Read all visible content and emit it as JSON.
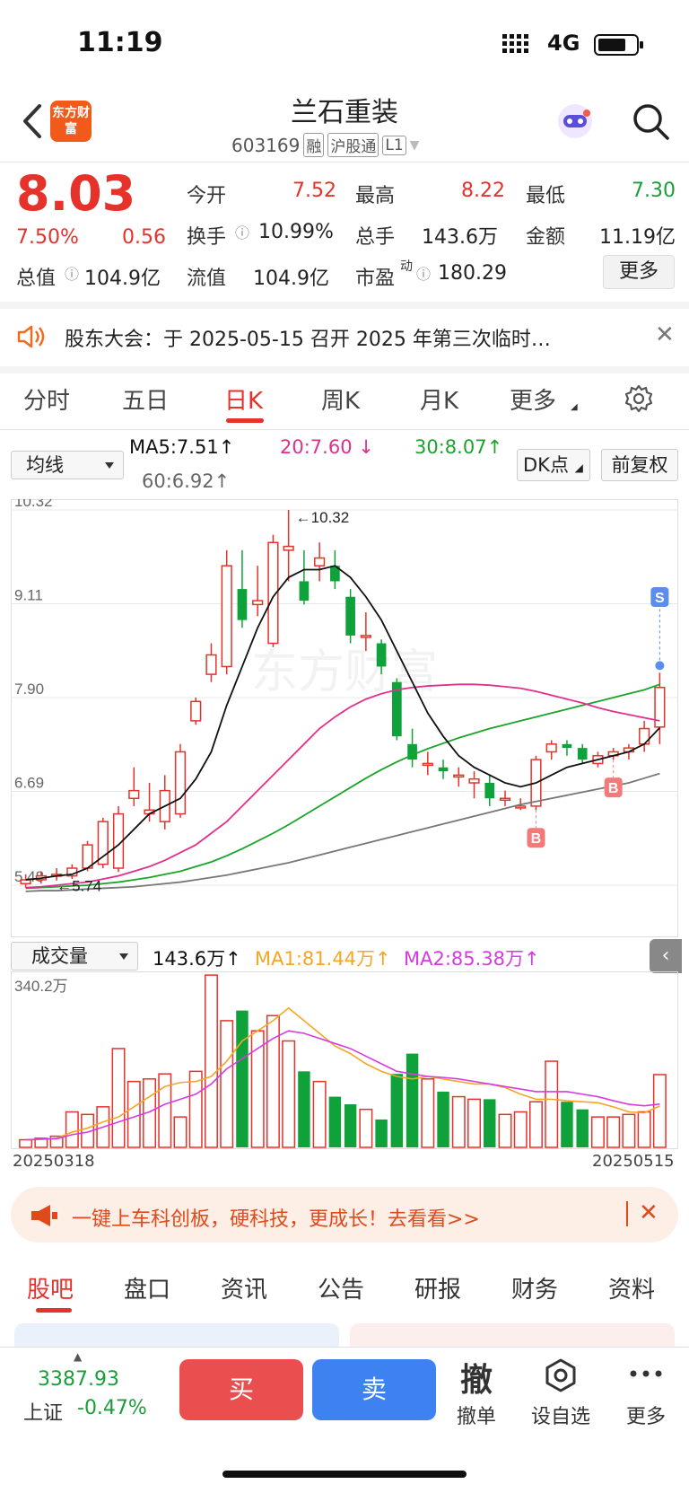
{
  "status_bar": {
    "time": "11:19",
    "network": "4G"
  },
  "header": {
    "logo_text": "东方财富",
    "stock_name": "兰石重装",
    "stock_code": "603169",
    "tags": [
      "融",
      "沪股通",
      "L1"
    ]
  },
  "quote": {
    "price": "8.03",
    "change_pct": "7.50%",
    "change": "0.56",
    "stats": [
      {
        "label": "今开",
        "value": "7.52"
      },
      {
        "label": "最高",
        "value": "8.22"
      },
      {
        "label": "最低",
        "value": "7.30"
      },
      {
        "label": "换手",
        "value": "10.99%"
      },
      {
        "label": "总手",
        "value": "143.6万"
      },
      {
        "label": "金额",
        "value": "11.19亿"
      },
      {
        "label": "总值",
        "value": "104.9亿"
      },
      {
        "label": "流值",
        "value": "104.9亿"
      },
      {
        "label": "市盈",
        "value": "180.29",
        "superscript": "动"
      }
    ],
    "more_label": "更多"
  },
  "notice": {
    "text": "股东大会：于 2025-05-15 召开 2025 年第三次临时…"
  },
  "period_tabs": [
    "分时",
    "五日",
    "日K",
    "周K",
    "月K",
    "更多"
  ],
  "active_period": "日K",
  "ma_legend": {
    "select_label": "均线",
    "ma5": "MA5:7.51",
    "ma20": "20:7.60",
    "ma30": "30:8.07",
    "ma60": "60:6.92",
    "dk_label": "DK点",
    "adjust_label": "前复权",
    "colors": {
      "ma5": "#111111",
      "ma20": "#e0308c",
      "ma30": "#1aa52a",
      "ma60": "#777777"
    }
  },
  "chart_data": [
    {
      "type": "candlestick",
      "title": "日K",
      "y_ticks": [
        "10.32",
        "9.11",
        "7.90",
        "6.69",
        "5.48"
      ],
      "ylim": [
        5.48,
        10.32
      ],
      "watermark": "东方财富",
      "annotations": [
        "10.32",
        "5.74"
      ],
      "signal_markers": [
        "S",
        "B",
        "B"
      ],
      "candles": [
        [
          5.5,
          5.55,
          5.62,
          5.45
        ],
        [
          5.55,
          5.6,
          5.66,
          5.5
        ],
        [
          5.6,
          5.62,
          5.7,
          5.54
        ],
        [
          5.6,
          5.7,
          5.75,
          5.56
        ],
        [
          5.7,
          6.0,
          6.05,
          5.66
        ],
        [
          5.75,
          6.3,
          6.35,
          5.7
        ],
        [
          5.7,
          6.4,
          6.5,
          5.65
        ],
        [
          6.6,
          6.7,
          7.0,
          6.5
        ],
        [
          6.4,
          6.45,
          6.8,
          6.3
        ],
        [
          6.3,
          6.7,
          6.9,
          6.2
        ],
        [
          6.4,
          7.2,
          7.3,
          6.35
        ],
        [
          7.6,
          7.85,
          7.9,
          7.55
        ],
        [
          8.2,
          8.45,
          8.6,
          8.1
        ],
        [
          8.3,
          9.6,
          9.8,
          8.2
        ],
        [
          9.3,
          8.9,
          9.8,
          8.8
        ],
        [
          9.1,
          9.15,
          9.6,
          8.95
        ],
        [
          8.6,
          9.9,
          10.0,
          8.55
        ],
        [
          9.8,
          9.85,
          10.32,
          9.4
        ],
        [
          9.4,
          9.15,
          9.8,
          9.1
        ],
        [
          9.6,
          9.7,
          9.9,
          9.4
        ],
        [
          9.6,
          9.4,
          9.8,
          9.3
        ],
        [
          9.2,
          8.7,
          9.3,
          8.6
        ],
        [
          8.7,
          8.7,
          9.0,
          8.5
        ],
        [
          8.6,
          8.3,
          8.65,
          8.2
        ],
        [
          8.1,
          7.4,
          8.15,
          7.35
        ],
        [
          7.3,
          7.1,
          7.5,
          7.0
        ],
        [
          7.05,
          7.05,
          7.2,
          6.9
        ],
        [
          7.0,
          6.95,
          7.1,
          6.85
        ],
        [
          6.9,
          6.9,
          7.0,
          6.75
        ],
        [
          6.8,
          6.85,
          6.95,
          6.6
        ],
        [
          6.8,
          6.6,
          6.9,
          6.5
        ],
        [
          6.6,
          6.6,
          6.7,
          6.5
        ],
        [
          6.5,
          6.5,
          6.6,
          6.45
        ],
        [
          6.5,
          7.1,
          7.15,
          6.45
        ],
        [
          7.2,
          7.3,
          7.35,
          7.1
        ],
        [
          7.3,
          7.25,
          7.35,
          7.15
        ],
        [
          7.25,
          7.1,
          7.3,
          7.05
        ],
        [
          7.05,
          7.15,
          7.2,
          7.0
        ],
        [
          7.15,
          7.2,
          7.25,
          7.1
        ],
        [
          7.2,
          7.25,
          7.3,
          7.1
        ],
        [
          7.3,
          7.5,
          7.6,
          7.2
        ],
        [
          7.52,
          8.03,
          8.22,
          7.3
        ]
      ],
      "ma5": [
        5.55,
        5.57,
        5.6,
        5.62,
        5.7,
        5.85,
        6.0,
        6.2,
        6.4,
        6.5,
        6.6,
        6.85,
        7.2,
        7.8,
        8.3,
        8.8,
        9.2,
        9.45,
        9.55,
        9.55,
        9.6,
        9.45,
        9.2,
        8.9,
        8.5,
        8.1,
        7.7,
        7.4,
        7.15,
        7.0,
        6.9,
        6.8,
        6.75,
        6.8,
        6.9,
        7.0,
        7.05,
        7.1,
        7.15,
        7.2,
        7.3,
        7.51
      ],
      "ma20": [
        5.45,
        5.46,
        5.48,
        5.5,
        5.52,
        5.56,
        5.6,
        5.66,
        5.72,
        5.8,
        5.9,
        6.0,
        6.15,
        6.3,
        6.5,
        6.7,
        6.9,
        7.1,
        7.3,
        7.5,
        7.65,
        7.78,
        7.88,
        7.95,
        8.0,
        8.03,
        8.05,
        8.06,
        8.07,
        8.07,
        8.06,
        8.04,
        8.02,
        7.98,
        7.93,
        7.88,
        7.83,
        7.77,
        7.72,
        7.68,
        7.64,
        7.6
      ],
      "ma30": [
        5.44,
        5.45,
        5.46,
        5.47,
        5.48,
        5.5,
        5.52,
        5.55,
        5.58,
        5.62,
        5.66,
        5.72,
        5.78,
        5.86,
        5.95,
        6.05,
        6.15,
        6.26,
        6.38,
        6.5,
        6.62,
        6.74,
        6.86,
        6.97,
        7.07,
        7.16,
        7.24,
        7.31,
        7.38,
        7.44,
        7.5,
        7.55,
        7.6,
        7.65,
        7.7,
        7.75,
        7.8,
        7.85,
        7.9,
        7.95,
        8.0,
        8.07
      ],
      "ma60": [
        5.4,
        5.41,
        5.41,
        5.42,
        5.43,
        5.44,
        5.45,
        5.46,
        5.48,
        5.5,
        5.52,
        5.55,
        5.58,
        5.61,
        5.65,
        5.69,
        5.73,
        5.77,
        5.82,
        5.87,
        5.92,
        5.97,
        6.02,
        6.07,
        6.12,
        6.17,
        6.22,
        6.27,
        6.32,
        6.37,
        6.42,
        6.47,
        6.52,
        6.56,
        6.6,
        6.64,
        6.68,
        6.72,
        6.76,
        6.8,
        6.86,
        6.92
      ]
    },
    {
      "type": "bar",
      "title": "成交量",
      "y_max_label": "340.2万",
      "x_start_label": "20250318",
      "x_end_label": "20250515",
      "values": [
        15,
        18,
        22,
        70,
        65,
        80,
        195,
        130,
        135,
        145,
        60,
        150,
        340,
        250,
        270,
        230,
        260,
        210,
        150,
        130,
        100,
        85,
        75,
        55,
        145,
        185,
        135,
        110,
        100,
        95,
        95,
        65,
        70,
        90,
        170,
        90,
        75,
        60,
        60,
        65,
        70,
        143.6
      ],
      "ma1_values": [
        15,
        16,
        18,
        30,
        38,
        50,
        60,
        80,
        100,
        120,
        128,
        130,
        140,
        170,
        210,
        230,
        250,
        275,
        250,
        225,
        200,
        185,
        165,
        150,
        140,
        135,
        140,
        135,
        130,
        125,
        125,
        118,
        105,
        95,
        95,
        92,
        90,
        88,
        80,
        70,
        68,
        81.44
      ],
      "ma2_values": [
        15,
        16,
        17,
        25,
        30,
        40,
        50,
        60,
        70,
        85,
        95,
        105,
        125,
        155,
        175,
        195,
        215,
        230,
        225,
        215,
        205,
        195,
        180,
        165,
        150,
        145,
        140,
        138,
        135,
        130,
        125,
        120,
        115,
        110,
        110,
        110,
        105,
        100,
        92,
        85,
        82,
        85.38
      ]
    }
  ],
  "volume_legend": {
    "select_label": "成交量",
    "volume": "143.6万",
    "ma1": "MA1:81.44万",
    "ma2": "MA2:85.38万",
    "colors": {
      "ma1": "#f5a623",
      "ma2": "#d63be0"
    }
  },
  "promo": {
    "text": "一键上车科创板，硬科技，更成长！去看看>>"
  },
  "section_tabs": [
    "股吧",
    "盘口",
    "资讯",
    "公告",
    "研报",
    "财务",
    "资料"
  ],
  "bottom_bar": {
    "index_value": "3387.93",
    "index_name": "上证",
    "index_change": "-0.47%",
    "buy_label": "买",
    "sell_label": "卖",
    "actions": [
      {
        "icon": "撤",
        "label": "撤单"
      },
      {
        "icon": "hexagon",
        "label": "设自选"
      },
      {
        "icon": "dots",
        "label": "更多"
      }
    ]
  }
}
